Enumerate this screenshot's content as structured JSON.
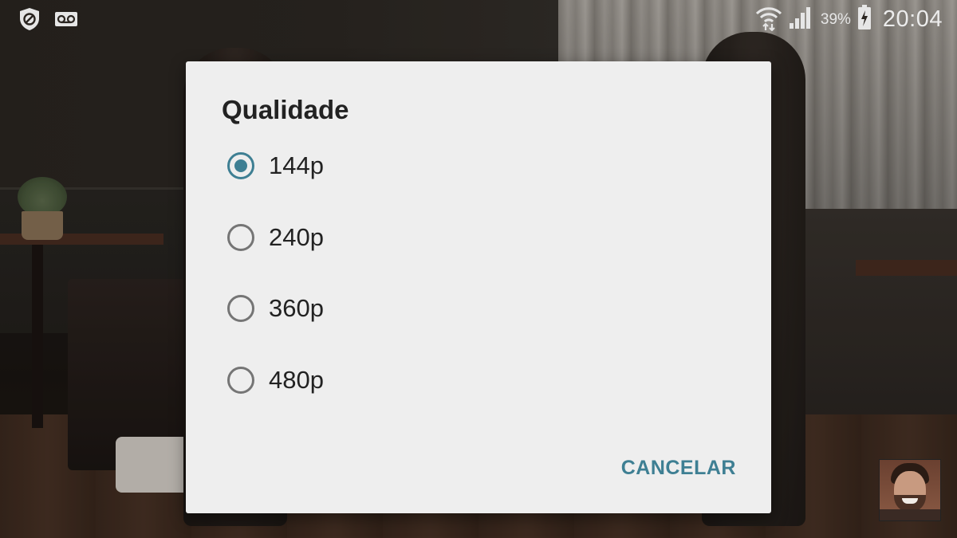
{
  "status_bar": {
    "left_icons": [
      "shield-block-icon",
      "voicemail-icon"
    ],
    "right_icons": [
      "wifi-icon",
      "signal-icon",
      "battery-charging-icon"
    ],
    "battery_percent": "39%",
    "time": "20:04"
  },
  "dialog": {
    "title": "Qualidade",
    "options": [
      {
        "label": "144p",
        "selected": true
      },
      {
        "label": "240p",
        "selected": false
      },
      {
        "label": "360p",
        "selected": false
      },
      {
        "label": "480p",
        "selected": false
      }
    ],
    "cancel_label": "CANCELAR"
  },
  "colors": {
    "accent": "#3e7f93",
    "dialog_bg": "#eeeeee",
    "text": "#222222"
  }
}
